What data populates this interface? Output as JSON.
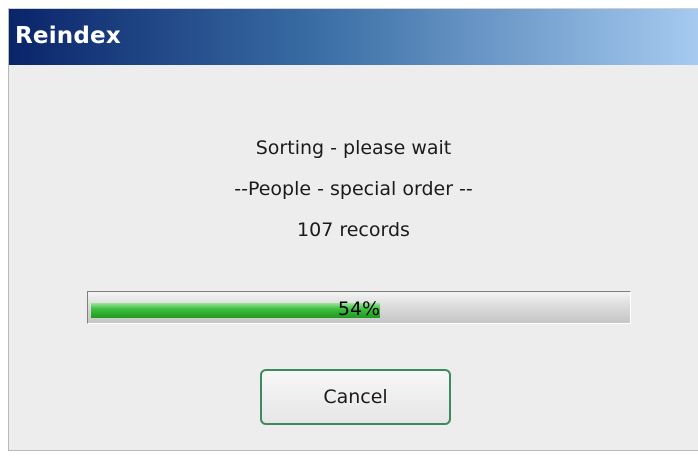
{
  "window": {
    "title": "Reindex"
  },
  "message": {
    "line1": "Sorting - please wait",
    "line2": "--People - special order --",
    "line3": "107 records"
  },
  "progress": {
    "value_percent": 54,
    "label": "54%"
  },
  "buttons": {
    "cancel_label": "Cancel"
  },
  "colors": {
    "progress_fill": "#3fbf3f",
    "title_gradient_start": "#0a246a",
    "title_gradient_end": "#a6caf0",
    "button_border": "#3c8a5e"
  }
}
